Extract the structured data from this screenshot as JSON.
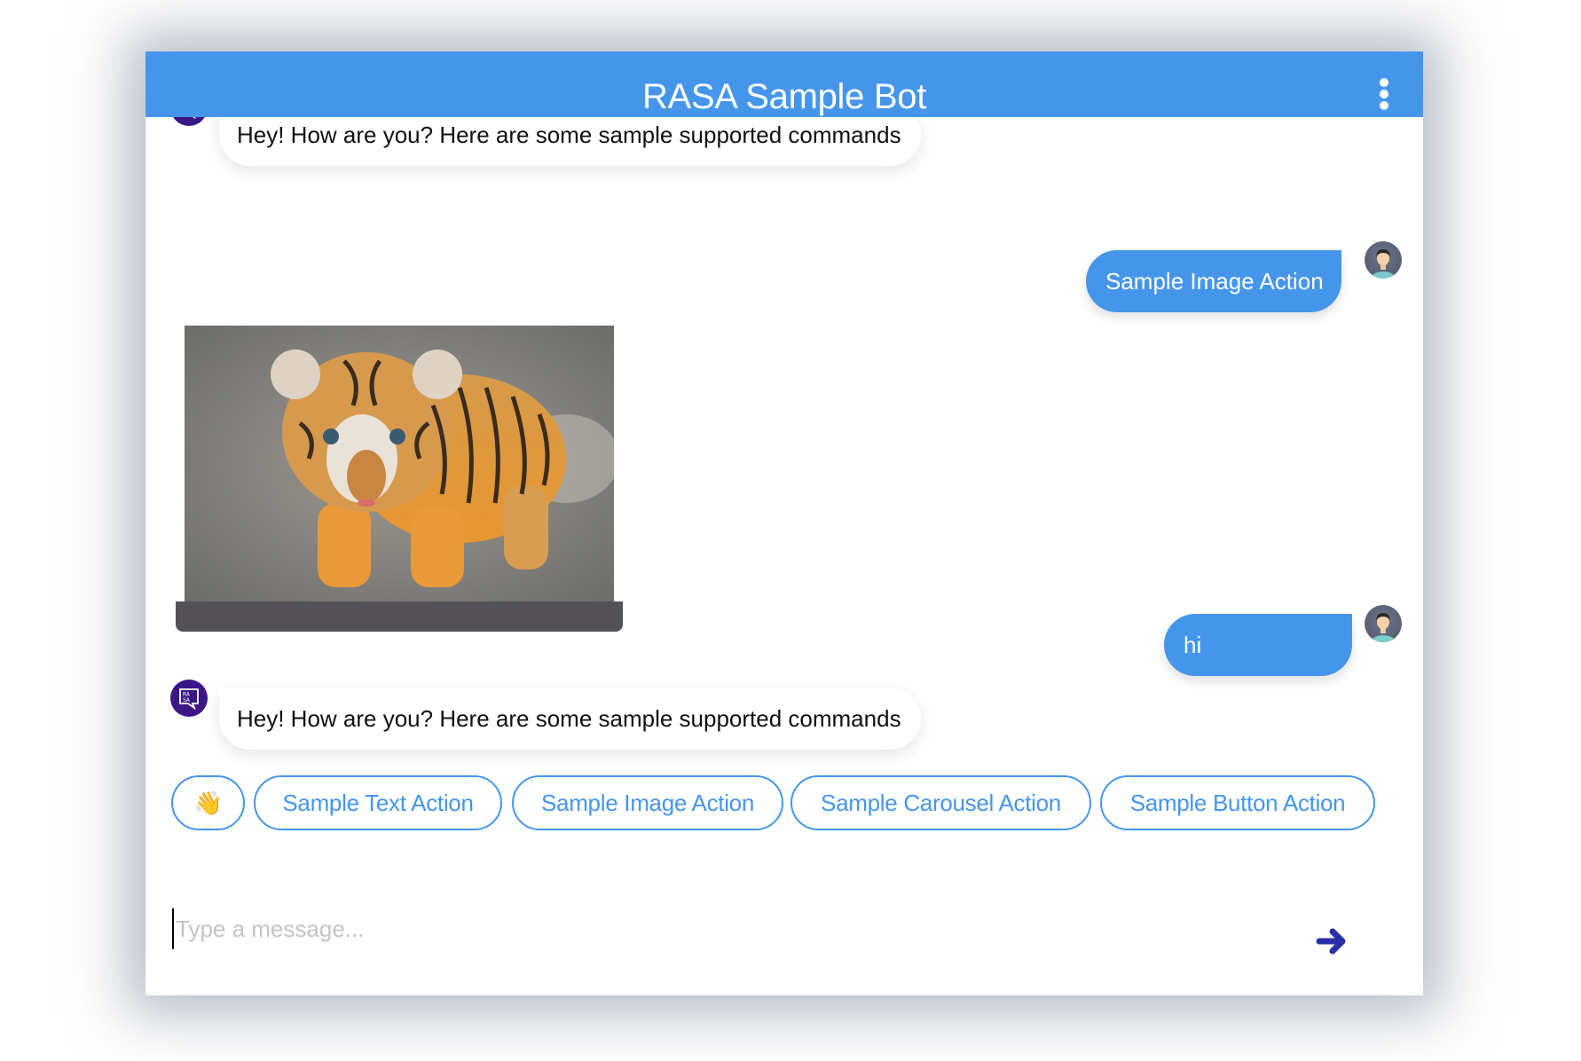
{
  "header": {
    "title": "RASA Sample Bot",
    "menu_icon": "more-vertical-icon",
    "background": "#4596eb"
  },
  "messages": [
    {
      "sender": "bot",
      "type": "text",
      "text": "Hey! How are you? Here are some sample supported commands"
    },
    {
      "sender": "user",
      "type": "text",
      "text": "Sample Image Action"
    },
    {
      "sender": "bot",
      "type": "image",
      "alt": "tiger cub"
    },
    {
      "sender": "user",
      "type": "text",
      "text": "hi"
    },
    {
      "sender": "bot",
      "type": "text",
      "text": "Hey! How are you? Here are some sample supported commands"
    }
  ],
  "quick_replies": [
    {
      "label": "👋"
    },
    {
      "label": "Sample Text Action"
    },
    {
      "label": "Sample Image Action"
    },
    {
      "label": "Sample Carousel Action"
    },
    {
      "label": "Sample Button Action"
    }
  ],
  "composer": {
    "placeholder": "Type a message...",
    "value": "",
    "send_icon": "arrow-right-icon"
  },
  "colors": {
    "accent": "#4596eb",
    "bot_avatar": "#3a1687",
    "send_icon": "#2a2fa8",
    "image_caption_bar": "#545256"
  }
}
